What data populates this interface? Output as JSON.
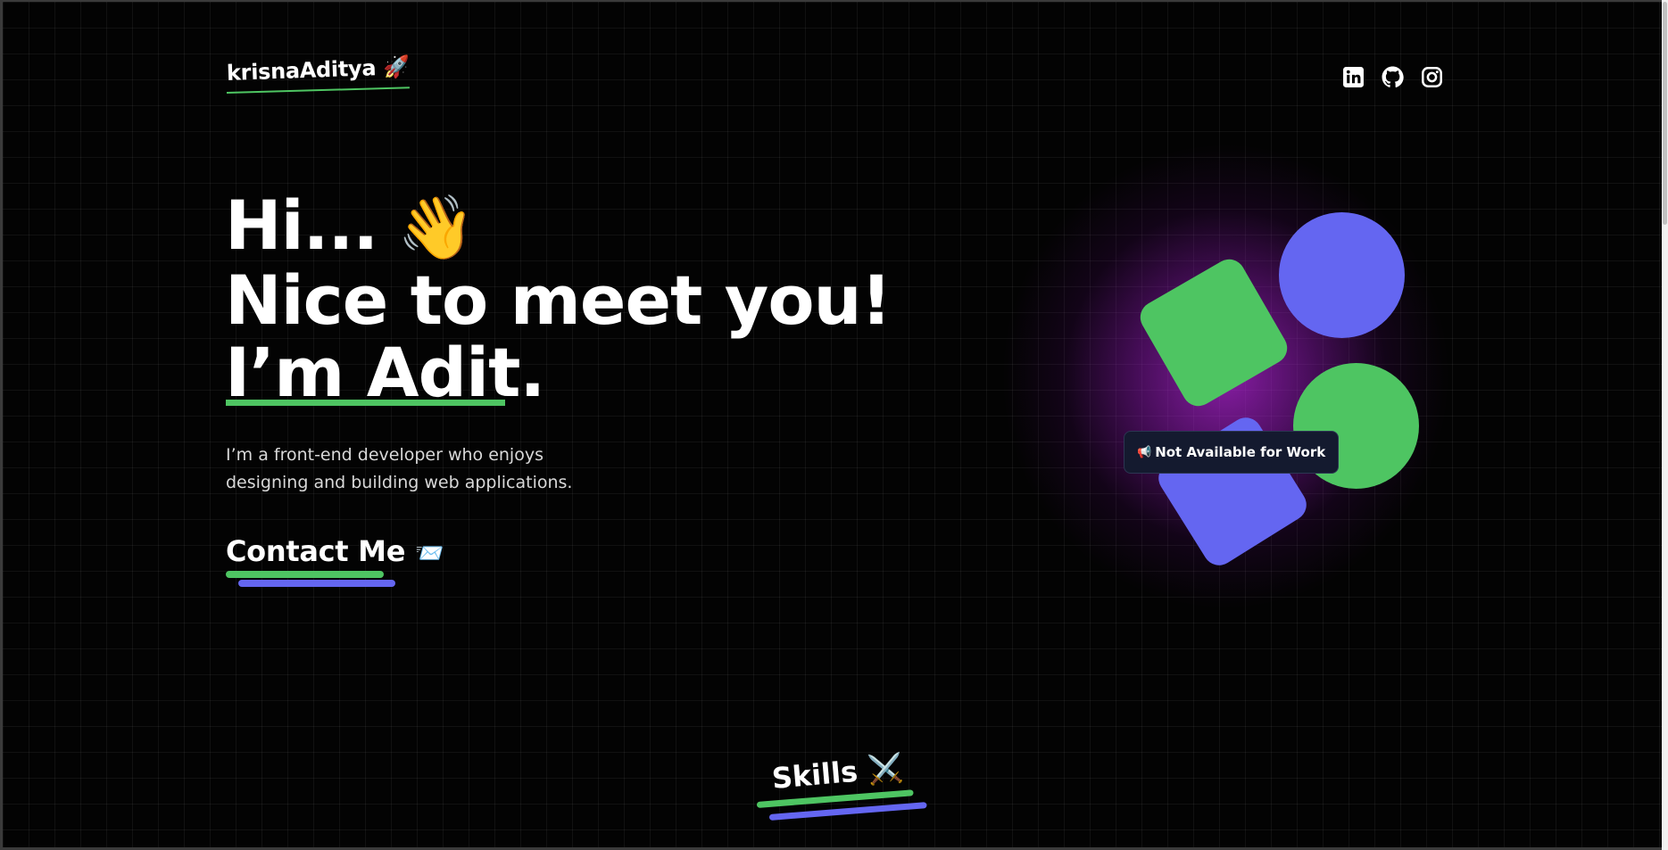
{
  "header": {
    "logo_text": "krisnaAditya 🚀",
    "social_icons": [
      "linkedin-icon",
      "github-icon",
      "instagram-icon"
    ]
  },
  "hero": {
    "line1": "Hi...",
    "line1_emoji": "👋",
    "line2": "Nice to meet you!",
    "line3": "I’m Adit.",
    "intro_line1": "I’m a front-end developer who enjoys",
    "intro_line2": "designing and building web applications.",
    "contact_label": "Contact Me",
    "contact_emoji": "📨"
  },
  "illustration": {
    "badge_icon": "📢",
    "badge_text": "Not Available for Work"
  },
  "skills": {
    "title": "Skills ⚔️"
  },
  "colors": {
    "background": "#030303",
    "accent_green": "#4ec562",
    "accent_blue": "#6466f1",
    "glow_purple": "#be28e6",
    "badge_bg": "#141a2f"
  }
}
